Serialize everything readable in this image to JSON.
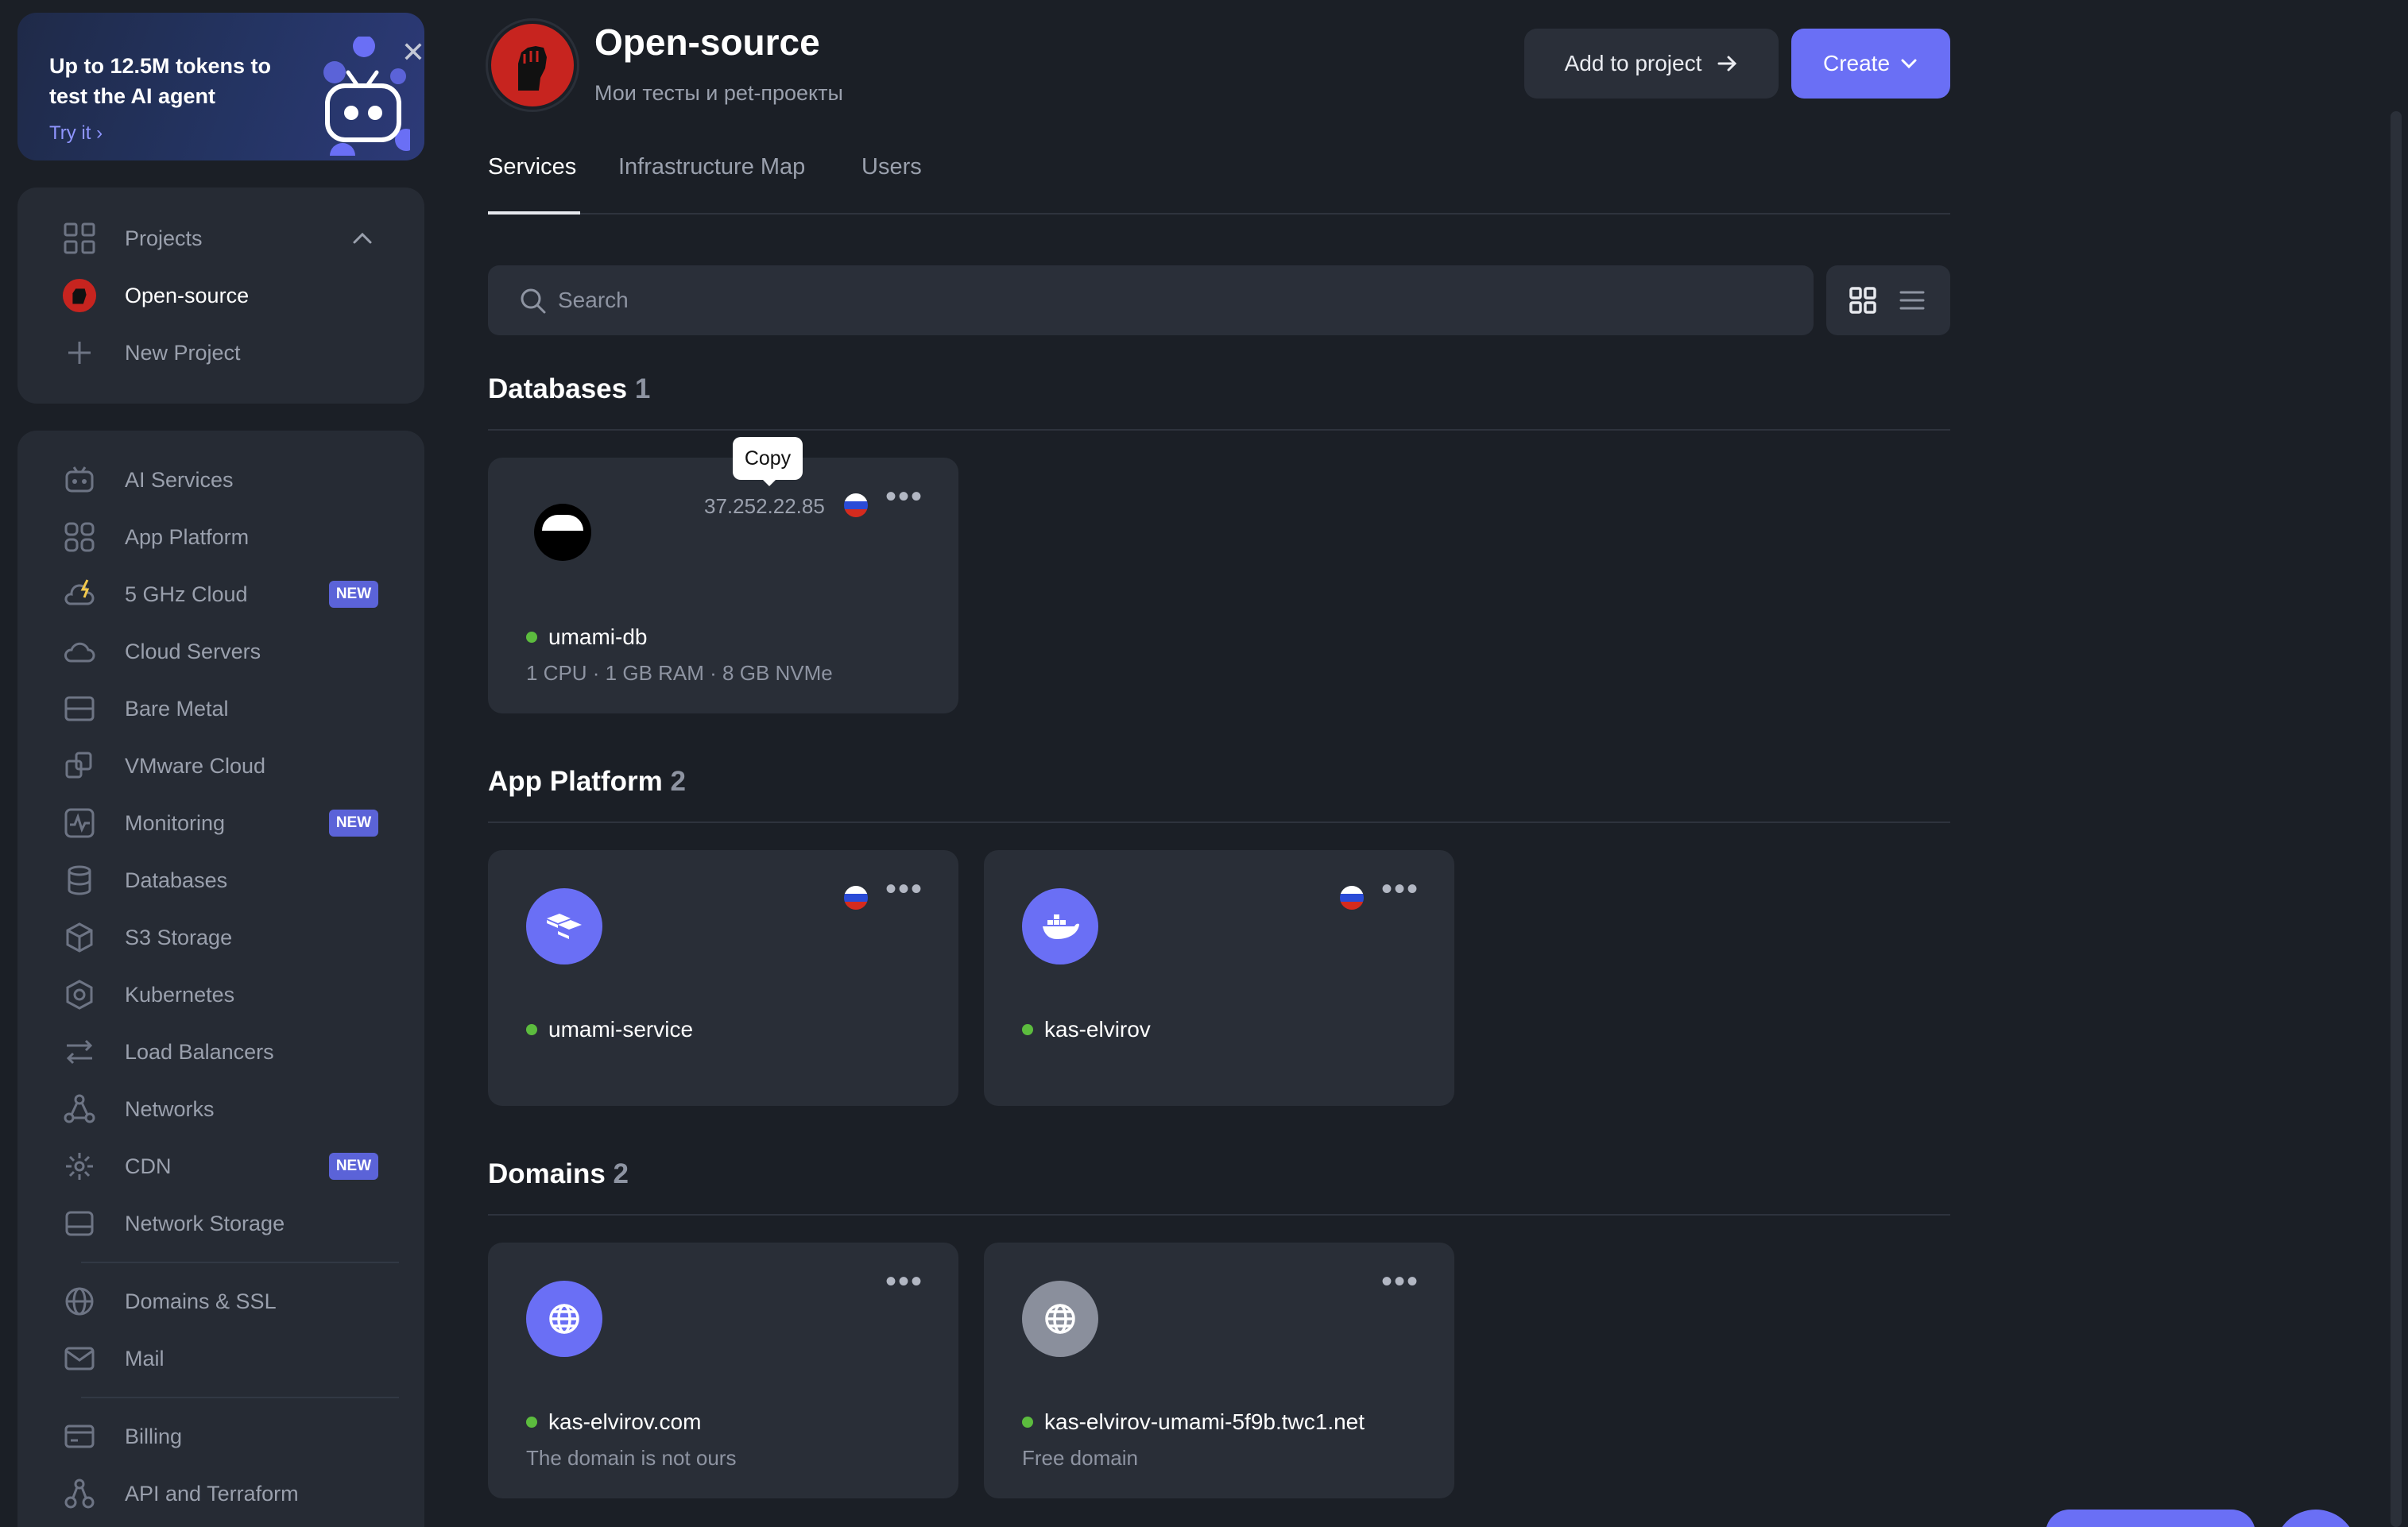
{
  "promo": {
    "title": "Up to 12.5M tokens to test the AI agent",
    "link": "Try it",
    "close": "✕"
  },
  "projects": {
    "header": "Projects",
    "items": [
      {
        "label": "Open-source"
      },
      {
        "label": "New Project"
      }
    ]
  },
  "sidebar": {
    "items": [
      {
        "label": "AI Services",
        "icon": "robot-icon"
      },
      {
        "label": "App Platform",
        "icon": "apps-icon"
      },
      {
        "label": "5 GHz Cloud",
        "icon": "lightning-cloud-icon",
        "badge": "NEW"
      },
      {
        "label": "Cloud Servers",
        "icon": "cloud-icon"
      },
      {
        "label": "Bare Metal",
        "icon": "server-icon"
      },
      {
        "label": "VMware Cloud",
        "icon": "vmware-icon"
      },
      {
        "label": "Monitoring",
        "icon": "monitoring-icon",
        "badge": "NEW"
      },
      {
        "label": "Databases",
        "icon": "database-icon"
      },
      {
        "label": "S3 Storage",
        "icon": "cube-icon"
      },
      {
        "label": "Kubernetes",
        "icon": "kubernetes-icon"
      },
      {
        "label": "Load Balancers",
        "icon": "arrows-icon"
      },
      {
        "label": "Networks",
        "icon": "network-icon"
      },
      {
        "label": "CDN",
        "icon": "cdn-icon",
        "badge": "NEW"
      },
      {
        "label": "Network Storage",
        "icon": "storage-icon"
      },
      {
        "label": "Domains & SSL",
        "icon": "globe-icon"
      },
      {
        "label": "Mail",
        "icon": "mail-icon"
      },
      {
        "label": "Billing",
        "icon": "billing-icon"
      },
      {
        "label": "API and Terraform",
        "icon": "api-icon"
      }
    ]
  },
  "header": {
    "title": "Open-source",
    "subtitle": "Мои тесты и pet-проекты",
    "add_button": "Add to project",
    "create_button": "Create"
  },
  "tabs": [
    {
      "label": "Services"
    },
    {
      "label": "Infrastructure Map"
    },
    {
      "label": "Users"
    }
  ],
  "search": {
    "placeholder": "Search"
  },
  "sections": {
    "databases": {
      "title": "Databases",
      "count": "1",
      "cards": [
        {
          "name": "umami-db",
          "sub": "1 CPU · 1 GB RAM · 8 GB NVMe",
          "ip": "37.252.22.85",
          "tooltip": "Copy"
        }
      ]
    },
    "app_platform": {
      "title": "App Platform",
      "count": "2",
      "cards": [
        {
          "name": "umami-service"
        },
        {
          "name": "kas-elvirov"
        }
      ]
    },
    "domains": {
      "title": "Domains",
      "count": "2",
      "cards": [
        {
          "name": "kas-elvirov.com",
          "sub": "The domain is not ours"
        },
        {
          "name": "kas-elvirov-umami-5f9b.twc1.net",
          "sub": "Free domain"
        }
      ]
    }
  },
  "more_label": "•••",
  "colors": {
    "accent": "#6a6ff5",
    "status_ok": "#5cbc3e",
    "background": "#1b1f26",
    "card": "#292e37"
  }
}
